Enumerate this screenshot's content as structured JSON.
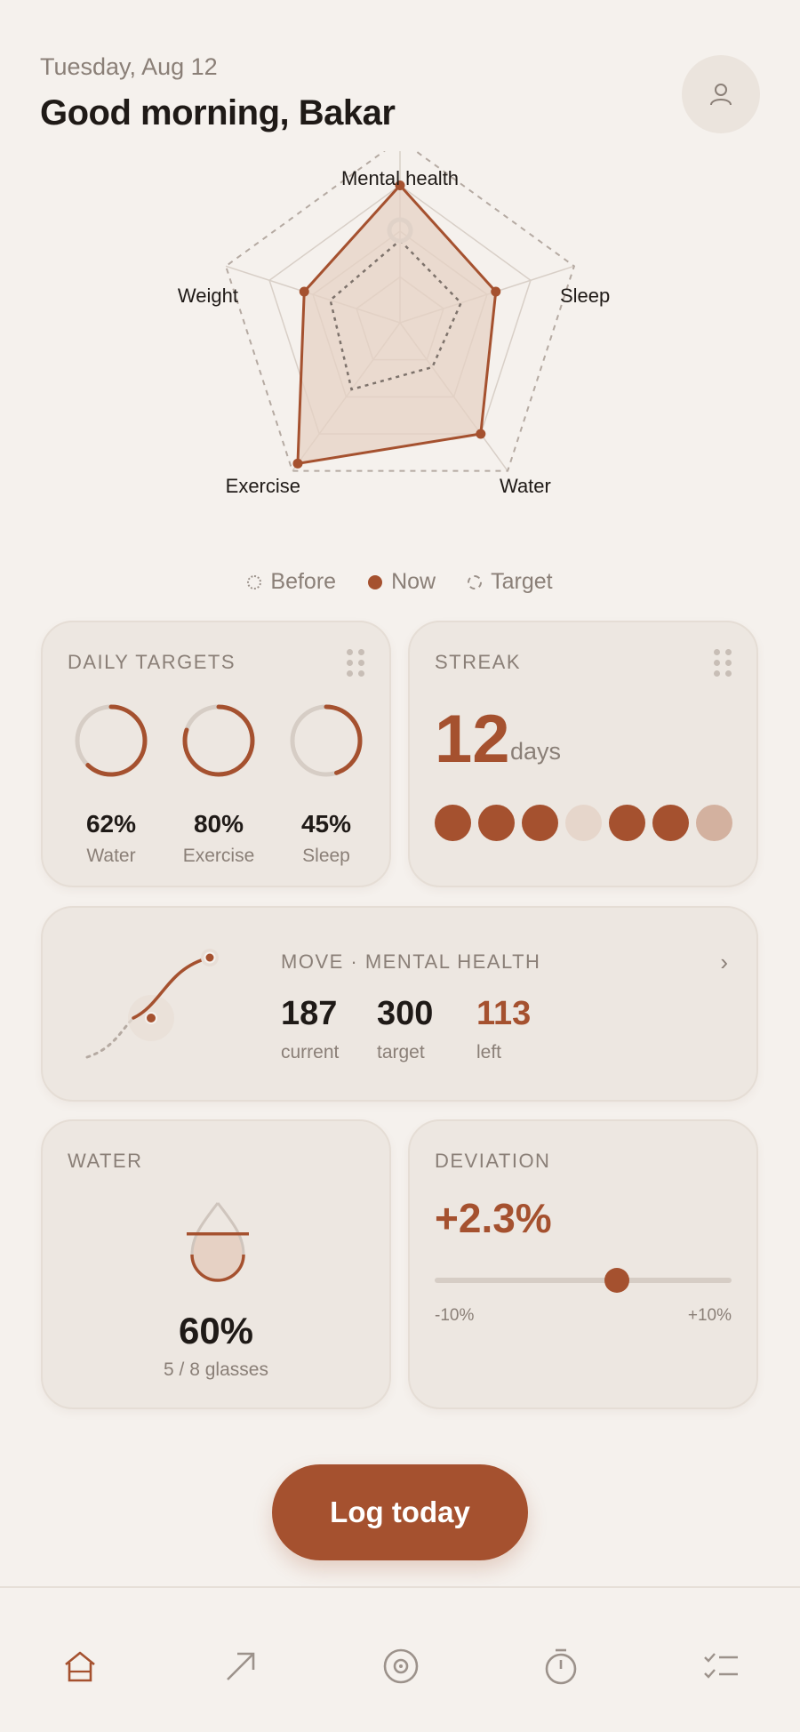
{
  "header": {
    "date": "Tuesday, Aug 12",
    "greeting": "Good morning, Bakar",
    "avatar_icon": "user-icon"
  },
  "radar": {
    "axes": [
      "Mental health",
      "Sleep",
      "Water",
      "Exercise",
      "Weight"
    ],
    "axis_labels": {
      "mental": "Mental health",
      "sleep": "Sleep",
      "water": "Water",
      "exercise": "Exercise",
      "weight": "Weight"
    },
    "series": [
      {
        "name": "Before",
        "values": [
          0.45,
          0.35,
          0.3,
          0.45,
          0.4
        ]
      },
      {
        "name": "Now",
        "values": [
          0.75,
          0.55,
          0.75,
          0.95,
          0.55
        ]
      },
      {
        "name": "Target",
        "values": [
          1,
          1,
          1,
          1,
          1
        ]
      }
    ],
    "colors": {
      "now": "#a5512f",
      "fill": "#e6d1c4",
      "grid": "#cfc5bd"
    }
  },
  "legend": {
    "before": "Before",
    "now": "Now",
    "target": "Target"
  },
  "daily_targets": {
    "title": "DAILY TARGETS",
    "items": [
      {
        "value": "62%",
        "label": "Water",
        "fraction": 0.62
      },
      {
        "value": "80%",
        "label": "Exercise",
        "fraction": 0.8
      },
      {
        "value": "45%",
        "label": "Sleep",
        "fraction": 0.45
      }
    ]
  },
  "streak": {
    "title": "STREAK",
    "number": "12",
    "unit": "days",
    "days": [
      "done",
      "done",
      "done",
      "missed",
      "done",
      "done",
      "partial"
    ]
  },
  "move": {
    "title": "MOVE · MENTAL HEALTH",
    "current": {
      "value": "187",
      "label": "current"
    },
    "target": {
      "value": "300",
      "label": "target"
    },
    "left": {
      "value": "113",
      "label": "left"
    }
  },
  "water": {
    "title": "WATER",
    "value": "60%",
    "sub": "5 / 8 glasses",
    "fraction": 0.6
  },
  "deviation": {
    "title": "DEVIATION",
    "value": "+2.3%",
    "min_label": "-10%",
    "max_label": "+10%",
    "min": -10,
    "max": 10,
    "current": 2.3
  },
  "cta": {
    "label": "Log today"
  },
  "nav": [
    "home-icon",
    "trend-icon",
    "target-icon",
    "timer-icon",
    "checklist-icon"
  ]
}
